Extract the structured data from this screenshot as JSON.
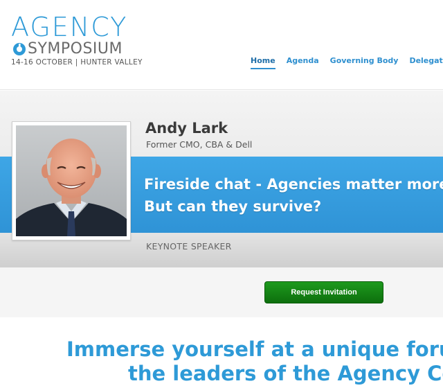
{
  "logo": {
    "line1": "AGENCY",
    "line2": "SYMPOSIUM",
    "dates": "14-16 OCTOBER | HUNTER VALLEY",
    "mark_icon": "agency-symposium-logo-mark"
  },
  "nav": {
    "items": [
      {
        "label": "Home",
        "active": true
      },
      {
        "label": "Agenda",
        "active": false
      },
      {
        "label": "Governing Body",
        "active": false
      },
      {
        "label": "Delegates",
        "active": false
      }
    ]
  },
  "speaker": {
    "name": "Andy Lark",
    "title": "Former CMO, CBA & Dell",
    "talk_line1": "Fireside chat - Agencies matter more than ever.",
    "talk_line2": "But can they survive?",
    "role": "KEYNOTE SPEAKER",
    "photo_icon": "speaker-portrait"
  },
  "cta": {
    "label": "Request Invitation"
  },
  "tagline": {
    "line1": "Immerse yourself at a unique forum",
    "line2": "the leaders of the Agency Com"
  },
  "colors": {
    "brand_blue": "#2e9ad7",
    "band_blue": "#3ea6e6",
    "cta_green": "#138513",
    "text_dark": "#3a3a3a"
  }
}
